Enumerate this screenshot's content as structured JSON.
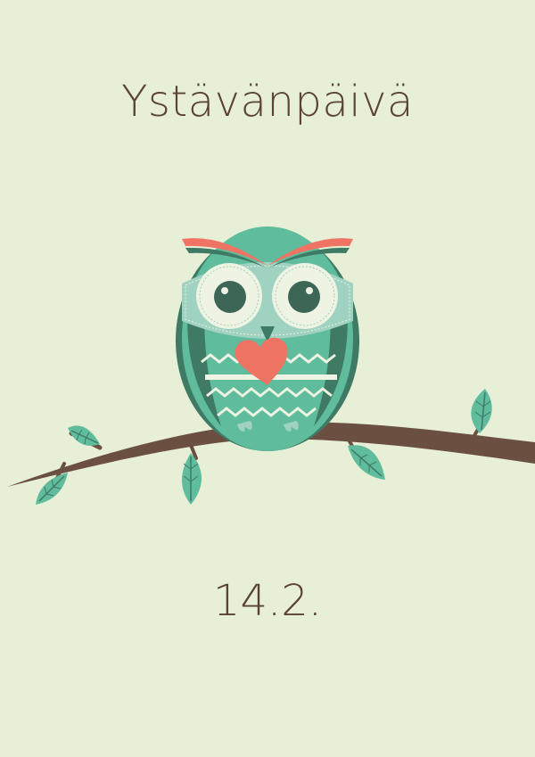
{
  "card": {
    "title": "Ystävänpäivä",
    "date": "14.2."
  },
  "colors": {
    "background": "#e7f0d6",
    "text": "#5a4236",
    "owl_body": "#5fbc9d",
    "owl_dark": "#3f7a65",
    "owl_light": "#9fd2c0",
    "eye_white": "#eef3e3",
    "pupil": "#3d6657",
    "heart": "#ef7464",
    "branch": "#6b5041",
    "leaf": "#5fbc9d"
  },
  "icons": [
    "owl-illustration",
    "heart-icon",
    "branch-illustration",
    "leaf-icon"
  ]
}
